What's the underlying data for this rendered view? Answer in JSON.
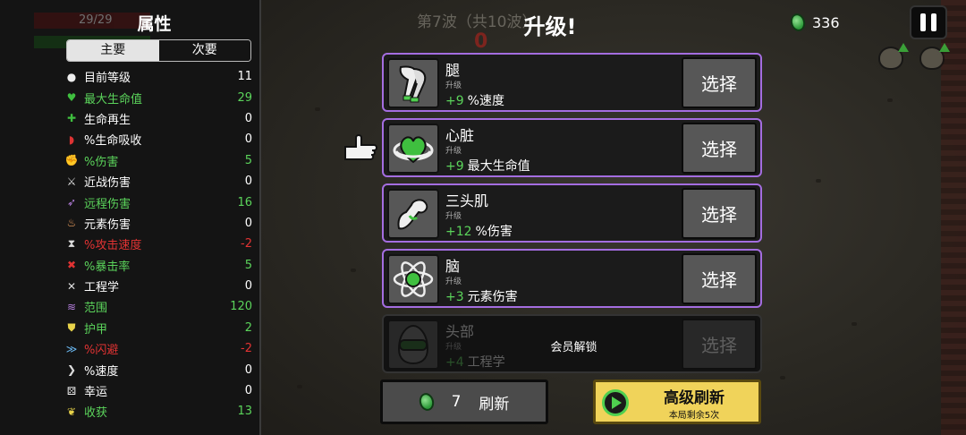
{
  "colors": {
    "accent_purple": "#a46de0",
    "green": "#5bd45b",
    "red": "#e23333",
    "gold": "#f0d35a"
  },
  "hud": {
    "hp_ghost": "29/29",
    "wave": "第7波（共10波）",
    "red_number": "0"
  },
  "panel": {
    "title": "属性",
    "tabs": [
      {
        "label": "主要",
        "active": true
      },
      {
        "label": "次要",
        "active": false
      }
    ],
    "stats": [
      {
        "icon": "level-icon",
        "name": "目前等级",
        "value": "11",
        "color": "#ffffff"
      },
      {
        "icon": "heart-icon",
        "name": "最大生命值",
        "value": "29",
        "color": "#5bd45b"
      },
      {
        "icon": "regen-icon",
        "name": "生命再生",
        "value": "0",
        "color": "#ffffff"
      },
      {
        "icon": "lifesteal-icon",
        "name": "%生命吸收",
        "value": "0",
        "color": "#ffffff"
      },
      {
        "icon": "damage-icon",
        "name": "%伤害",
        "value": "5",
        "color": "#5bd45b"
      },
      {
        "icon": "melee-icon",
        "name": "近战伤害",
        "value": "0",
        "color": "#ffffff"
      },
      {
        "icon": "ranged-icon",
        "name": "远程伤害",
        "value": "16",
        "color": "#5bd45b"
      },
      {
        "icon": "elemental-icon",
        "name": "元素伤害",
        "value": "0",
        "color": "#ffffff"
      },
      {
        "icon": "hourglass-icon",
        "name": "%攻击速度",
        "value": "-2",
        "color": "#e23333"
      },
      {
        "icon": "crit-icon",
        "name": "%暴击率",
        "value": "5",
        "color": "#5bd45b"
      },
      {
        "icon": "wrench-icon",
        "name": "工程学",
        "value": "0",
        "color": "#ffffff"
      },
      {
        "icon": "range-icon",
        "name": "范围",
        "value": "120",
        "color": "#5bd45b"
      },
      {
        "icon": "armor-icon",
        "name": "护甲",
        "value": "2",
        "color": "#5bd45b"
      },
      {
        "icon": "dodge-icon",
        "name": "%闪避",
        "value": "-2",
        "color": "#e23333"
      },
      {
        "icon": "speed-icon",
        "name": "%速度",
        "value": "0",
        "color": "#ffffff"
      },
      {
        "icon": "dice-icon",
        "name": "幸运",
        "value": "0",
        "color": "#ffffff"
      },
      {
        "icon": "harvest-icon",
        "name": "收获",
        "value": "13",
        "color": "#5bd45b"
      }
    ]
  },
  "header": {
    "title": "升级!",
    "materials": "336"
  },
  "cards": [
    {
      "name": "腿",
      "sub": "升级",
      "plus": "+9",
      "effect": "%速度",
      "icon": "leg-icon",
      "button": "选择",
      "locked": false
    },
    {
      "name": "心脏",
      "sub": "升级",
      "plus": "+9",
      "effect": "最大生命值",
      "icon": "heart-ring-icon",
      "button": "选择",
      "locked": false
    },
    {
      "name": "三头肌",
      "sub": "升级",
      "plus": "+12",
      "effect": "%伤害",
      "icon": "arm-icon",
      "button": "选择",
      "locked": false
    },
    {
      "name": "脑",
      "sub": "升级",
      "plus": "+3",
      "effect": "元素伤害",
      "icon": "atom-icon",
      "button": "选择",
      "locked": false
    },
    {
      "name": "头部",
      "sub": "升级",
      "plus": "+4",
      "effect": "工程学",
      "icon": "helmet-icon",
      "button": "选择",
      "locked": true,
      "lock_text": "会员解锁"
    }
  ],
  "reroll": {
    "count": "7",
    "label": "刷新"
  },
  "premium": {
    "title": "高级刷新",
    "sub": "本局剩余5次"
  }
}
